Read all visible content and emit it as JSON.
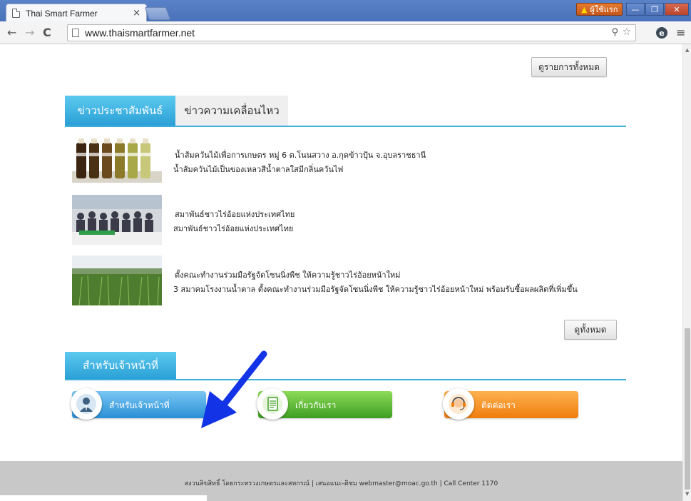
{
  "browser": {
    "tab_title": "Thai Smart Farmer",
    "tab_close": "×",
    "user_label": "ผู้ใช้แรก",
    "url": "www.thaismartfarmer.net",
    "window_controls": {
      "minimize": "—",
      "maximize": "❐",
      "close": "✕"
    },
    "icons": {
      "back": "back-arrow-icon",
      "forward": "forward-arrow-icon",
      "reload": "reload-icon",
      "zoom": "magnifier-icon",
      "star": "star-icon",
      "extension": "extension-icon",
      "menu": "hamburger-menu-icon",
      "warning": "warning-icon"
    }
  },
  "page": {
    "view_all_top": "ดูรายการทั้งหมด",
    "news_tabs": [
      {
        "label": "ข่าวประชาสัมพันธ์",
        "active": true
      },
      {
        "label": "ข่าวความเคลื่อนไหว",
        "active": false
      }
    ],
    "news_items": [
      {
        "title": "น้ำส้มควันไม้เพื่อการเกษตร หมู่ 6 ต.โนนสวาง อ.กุดข้าวปุ้น จ.อุบลราชธานี",
        "desc": "น้ำส้มควันไม้เป็นของเหลวสีน้ำตาลใสมีกลิ่นควันไฟ"
      },
      {
        "title": "สมาพันธ์ชาวไร่อ้อยแห่งประเทศไทย",
        "desc": "สมาพันธ์ชาวไร่อ้อยแห่งประเทศไทย"
      },
      {
        "title": "ตั้งคณะทำงานร่วมมือรัฐจัดโซนนิ่งพืช ให้ความรู้ชาวไร่อ้อยหน้าใหม่",
        "desc": "3 สมาคมโรงงานน้ำตาล ตั้งคณะทำงานร่วมมือรัฐจัดโซนนิ่งพืช ให้ความรู้ชาวไร่อ้อยหน้าใหม่ พร้อมรับซื้อผลผลิตที่เพิ่มขึ้น"
      }
    ],
    "view_all_bottom": "ดูทั้งหมด",
    "officer_section_title": "สำหรับเจ้าหน้าที่",
    "buttons": [
      {
        "label": "สำหรับเจ้าหน้าที่",
        "icon": "officer-person-icon"
      },
      {
        "label": "เกี่ยวกับเรา",
        "icon": "document-icon"
      },
      {
        "label": "ติดต่อเรา",
        "icon": "headset-support-icon"
      }
    ],
    "footer": "สงวนลิขสิทธิ์ โดยกระทรวงเกษตรและสหกรณ์ | เสนอแนะ-ติชม webmaster@moac.go.th | Call Center 1170"
  },
  "colors": {
    "tab_active": "#2ba0d6",
    "btn_officer": "#2a8fd6",
    "btn_about": "#3e9e21",
    "btn_contact": "#ee7d0c",
    "annotation_arrow": "#1233e6"
  }
}
